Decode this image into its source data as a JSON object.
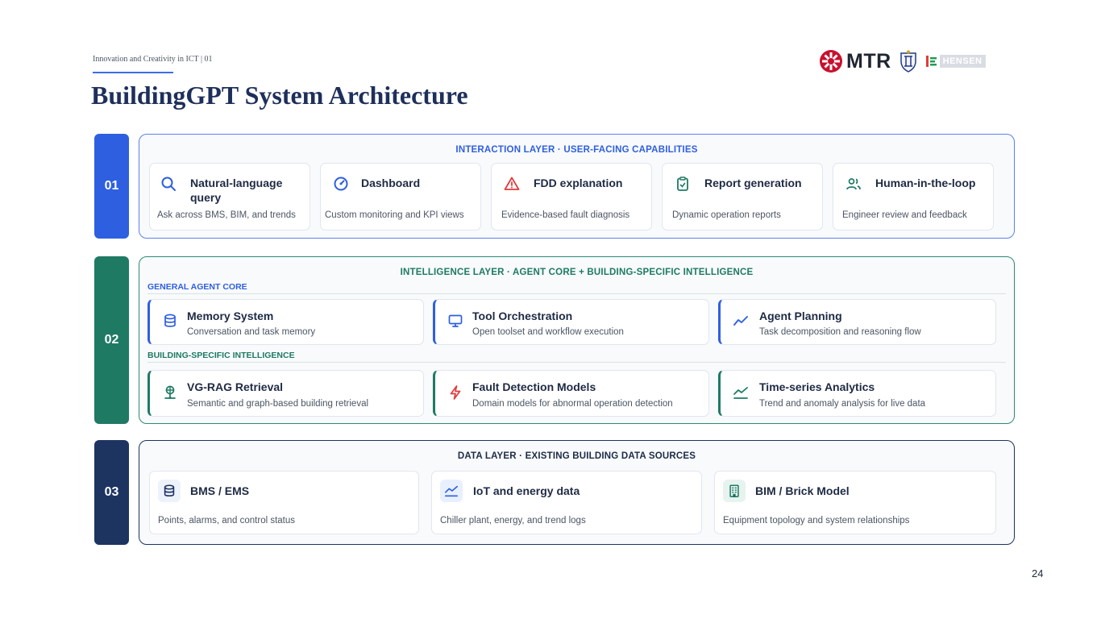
{
  "header": {
    "kicker": "Innovation and Creativity in ICT | 01",
    "title": "BuildingGPT System Architecture",
    "logo_mtr": "MTR",
    "logo_hensen": "HENSEN"
  },
  "layers": [
    {
      "number": "01",
      "title": "INTERACTION LAYER · USER-FACING CAPABILITIES",
      "cards": [
        {
          "title": "Natural-language query",
          "desc": "Ask across BMS, BIM, and trends",
          "icon": "search-icon"
        },
        {
          "title": "Dashboard",
          "desc": "Custom monitoring and KPI views",
          "icon": "gauge-icon"
        },
        {
          "title": "FDD explanation",
          "desc": "Evidence-based fault diagnosis",
          "icon": "warning-icon"
        },
        {
          "title": "Report generation",
          "desc": "Dynamic operation reports",
          "icon": "clipboard-icon"
        },
        {
          "title": "Human-in-the-loop",
          "desc": "Engineer review and feedback",
          "icon": "users-icon"
        }
      ]
    },
    {
      "number": "02",
      "title": "INTELLIGENCE LAYER · AGENT CORE + BUILDING-SPECIFIC INTELLIGENCE",
      "groups": [
        {
          "label": "GENERAL AGENT CORE",
          "cards": [
            {
              "title": "Memory System",
              "desc": "Conversation and task memory",
              "icon": "database-icon"
            },
            {
              "title": "Tool Orchestration",
              "desc": "Open toolset and workflow execution",
              "icon": "monitor-icon"
            },
            {
              "title": "Agent Planning",
              "desc": "Task decomposition and reasoning flow",
              "icon": "trend-icon"
            }
          ]
        },
        {
          "label": "BUILDING-SPECIFIC INTELLIGENCE",
          "cards": [
            {
              "title": "VG-RAG Retrieval",
              "desc": "Semantic and graph-based building retrieval",
              "icon": "network-icon"
            },
            {
              "title": "Fault Detection Models",
              "desc": "Domain models for abnormal operation detection",
              "icon": "lightning-icon"
            },
            {
              "title": "Time-series Analytics",
              "desc": "Trend and anomaly analysis for live data",
              "icon": "area-chart-icon"
            }
          ]
        }
      ]
    },
    {
      "number": "03",
      "title": "DATA LAYER · EXISTING BUILDING DATA SOURCES",
      "cards": [
        {
          "title": "BMS / EMS",
          "desc": "Points, alarms, and control status",
          "icon": "database-icon"
        },
        {
          "title": "IoT and energy data",
          "desc": "Chiller plant, energy, and trend logs",
          "icon": "area-chart-icon"
        },
        {
          "title": "BIM / Brick Model",
          "desc": "Equipment topology and system relationships",
          "icon": "building-icon"
        }
      ]
    }
  ],
  "colors": {
    "blue": "#2e5fe0",
    "green": "#1f7a64",
    "navy": "#1d3461",
    "red": "#e23b3b"
  },
  "page_number": "24"
}
